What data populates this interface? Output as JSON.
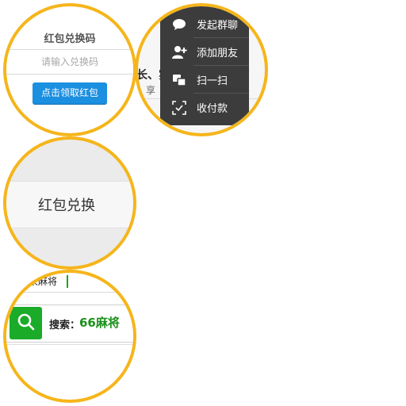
{
  "redeem_panel": {
    "title": "红包兑换码",
    "input_placeholder": "请输入兑换码",
    "submit_label": "点击领取红包"
  },
  "menu_panel": {
    "background_text": "长、实",
    "background_subtext": "享",
    "items": [
      {
        "label": "发起群聊",
        "icon": "chat-bubble-icon"
      },
      {
        "label": "添加朋友",
        "icon": "add-friend-icon"
      },
      {
        "label": "扫一扫",
        "icon": "scan-icon"
      },
      {
        "label": "收付款",
        "icon": "payment-scan-icon"
      }
    ]
  },
  "banner_panel": {
    "label": "红包兑换"
  },
  "search_panel": {
    "query_text": "来麻将",
    "search_prefix": "搜索：",
    "search_term": "66麻将",
    "search_icon": "search-icon"
  },
  "colors": {
    "circle_border": "#f5b51b",
    "primary_button": "#1b8fe0",
    "menu_background": "#3c3c3c",
    "search_green": "#1aab29",
    "term_green": "#1a8f1a"
  }
}
